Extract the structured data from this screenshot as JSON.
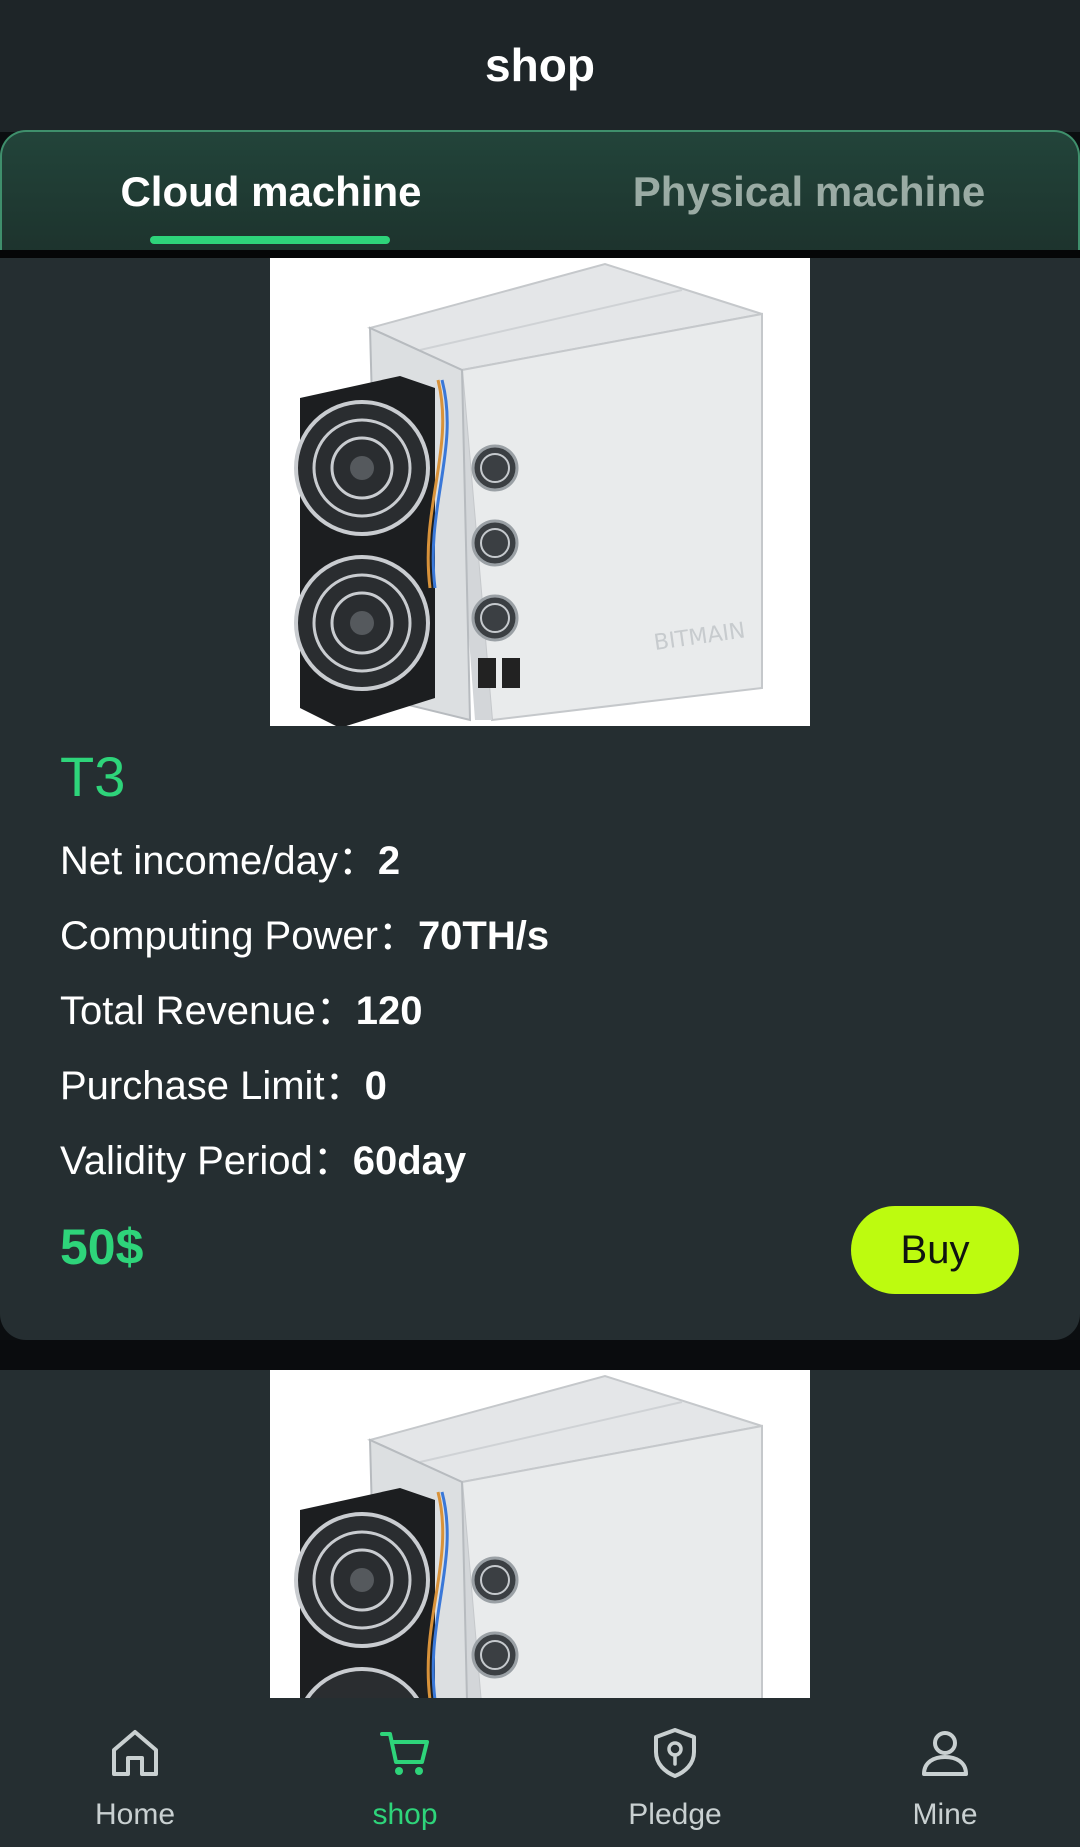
{
  "header": {
    "title": "shop"
  },
  "tabs": [
    {
      "label": "Cloud machine",
      "active": true
    },
    {
      "label": "Physical machine",
      "active": false
    }
  ],
  "products": [
    {
      "name": "T3",
      "brand_mark": "BITMAIN",
      "specs": [
        {
          "label": "Net income/day：",
          "value": "2"
        },
        {
          "label": "Computing Power：",
          "value": "70TH/s"
        },
        {
          "label": "Total Revenue：",
          "value": "120"
        },
        {
          "label": "Purchase Limit：",
          "value": "0"
        },
        {
          "label": "Validity Period：",
          "value": "60day"
        }
      ],
      "price": "50$",
      "buy_label": "Buy"
    }
  ],
  "nav": [
    {
      "label": "Home",
      "icon": "home-icon",
      "active": false
    },
    {
      "label": "shop",
      "icon": "cart-icon",
      "active": true
    },
    {
      "label": "Pledge",
      "icon": "shield-icon",
      "active": false
    },
    {
      "label": "Mine",
      "icon": "user-icon",
      "active": false
    }
  ],
  "colors": {
    "accent": "#2ed47a",
    "buy_button": "#bdfb0f",
    "card_background": "#252e31",
    "header_background": "#1e2528"
  }
}
